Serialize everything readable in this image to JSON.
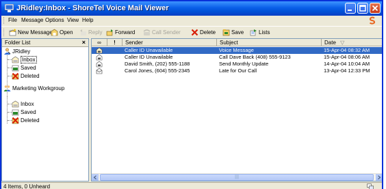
{
  "window": {
    "title": "JRidley:Inbox - ShoreTel Voice Mail Viewer"
  },
  "menu": {
    "items": [
      "File",
      "Message",
      "Options",
      "View",
      "Help"
    ]
  },
  "toolbar": {
    "new_message": "New Message",
    "open": "Open",
    "reply": "Reply",
    "forward": "Forward",
    "call_sender": "Call Sender",
    "delete": "Delete",
    "save": "Save",
    "lists": "Lists"
  },
  "folder_pane": {
    "title": "Folder List",
    "close": "×",
    "tree": [
      {
        "label": "JRidley",
        "level": 0,
        "icon": "user-icon"
      },
      {
        "label": "Inbox",
        "level": 1,
        "icon": "inbox-icon",
        "selected": true
      },
      {
        "label": "Saved",
        "level": 1,
        "icon": "saved-folder-icon"
      },
      {
        "label": "Deleted",
        "level": 1,
        "icon": "deleted-folder-icon"
      },
      {
        "label": "Marketing Workgroup",
        "level": 0,
        "icon": "workgroup-icon"
      },
      {
        "label": "Inbox",
        "level": 1,
        "icon": "inbox-icon"
      },
      {
        "label": "Saved",
        "level": 1,
        "icon": "saved-folder-icon"
      },
      {
        "label": "Deleted",
        "level": 1,
        "icon": "deleted-folder-icon"
      }
    ]
  },
  "list": {
    "columns": {
      "attachment": "∞",
      "priority": "!",
      "sender": "Sender",
      "subject": "Subject",
      "date": "Date",
      "sort_indicator": "▽"
    },
    "rows": [
      {
        "sender": "Caller ID Unavailable",
        "subject": "Voice Message",
        "date": "15-Apr-04 08:32 AM",
        "selected": true
      },
      {
        "sender": "Caller ID Unavailable",
        "subject": "Call Dave Back (408) 555-9123",
        "date": "15-Apr-04 08:06 AM"
      },
      {
        "sender": "David Smith, (202) 555-1188",
        "subject": "Send Monthly Update",
        "date": "14-Apr-04 10:04 AM"
      },
      {
        "sender": "Carol Jones, (604) 555-2345",
        "subject": "Late for Our Call",
        "date": "13-Apr-04 12:33 PM"
      }
    ],
    "scrollbar": {
      "thumb_grip": "|||"
    }
  },
  "status": {
    "text": "4 Items, 0 Unheard"
  },
  "colors": {
    "title_gradient_top": "#3d95ff",
    "title_gradient_bottom": "#0a3fc4",
    "selection": "#316ac5",
    "window_face": "#ece9d8",
    "brand_orange": "#e8641e"
  }
}
